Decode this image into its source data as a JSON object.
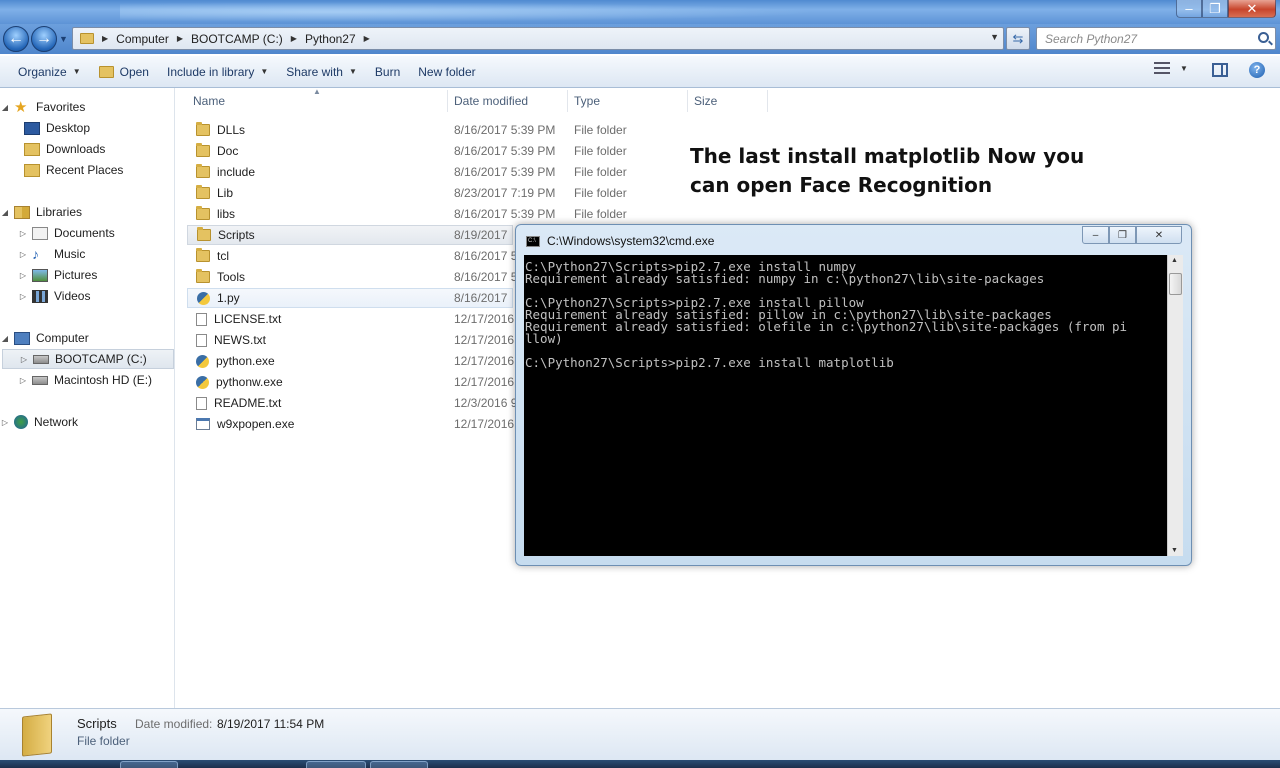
{
  "window": {
    "caption_buttons": {
      "minimize": "–",
      "maximize": "❐",
      "close": "✕"
    }
  },
  "nav": {
    "back": "←",
    "forward": "→",
    "breadcrumbs": [
      "Computer",
      "BOOTCAMP (C:)",
      "Python27"
    ],
    "search_placeholder": "Search Python27"
  },
  "toolbar": {
    "organize": "Organize",
    "open": "Open",
    "include_in_library": "Include in library",
    "share_with": "Share with",
    "burn": "Burn",
    "new_folder": "New folder",
    "help": "?"
  },
  "sidebar": {
    "favorites": "Favorites",
    "desktop": "Desktop",
    "downloads": "Downloads",
    "recent_places": "Recent Places",
    "libraries": "Libraries",
    "documents": "Documents",
    "music": "Music",
    "pictures": "Pictures",
    "videos": "Videos",
    "computer": "Computer",
    "bootcamp": "BOOTCAMP (C:)",
    "macintosh": "Macintosh HD (E:)",
    "network": "Network"
  },
  "columns": {
    "name": "Name",
    "date_modified": "Date modified",
    "type": "Type",
    "size": "Size"
  },
  "files": [
    {
      "name": "DLLs",
      "date": "8/16/2017 5:39 PM",
      "type": "File folder",
      "icon": "folder-icon"
    },
    {
      "name": "Doc",
      "date": "8/16/2017 5:39 PM",
      "type": "File folder",
      "icon": "folder-icon"
    },
    {
      "name": "include",
      "date": "8/16/2017 5:39 PM",
      "type": "File folder",
      "icon": "folder-icon"
    },
    {
      "name": "Lib",
      "date": "8/23/2017 7:19 PM",
      "type": "File folder",
      "icon": "folder-icon"
    },
    {
      "name": "libs",
      "date": "8/16/2017 5:39 PM",
      "type": "File folder",
      "icon": "folder-icon"
    },
    {
      "name": "Scripts",
      "date": "8/19/2017",
      "type": "",
      "icon": "folder-icon"
    },
    {
      "name": "tcl",
      "date": "8/16/2017 5",
      "type": "",
      "icon": "folder-icon"
    },
    {
      "name": "Tools",
      "date": "8/16/2017 5",
      "type": "",
      "icon": "folder-icon"
    },
    {
      "name": "1.py",
      "date": "8/16/2017",
      "type": "",
      "icon": "python-file-icon"
    },
    {
      "name": "LICENSE.txt",
      "date": "12/17/2016",
      "type": "",
      "icon": "text-file-icon"
    },
    {
      "name": "NEWS.txt",
      "date": "12/17/2016",
      "type": "",
      "icon": "text-file-icon"
    },
    {
      "name": "python.exe",
      "date": "12/17/2016",
      "type": "",
      "icon": "python-file-icon"
    },
    {
      "name": "pythonw.exe",
      "date": "12/17/2016",
      "type": "",
      "icon": "python-file-icon"
    },
    {
      "name": "README.txt",
      "date": "12/3/2016 9",
      "type": "",
      "icon": "text-file-icon"
    },
    {
      "name": "w9xpopen.exe",
      "date": "12/17/2016",
      "type": "",
      "icon": "exe-file-icon"
    }
  ],
  "caption_text": "The last install matplotlib Now you can open Face Recognition",
  "cmd": {
    "title": "C:\\Windows\\system32\\cmd.exe",
    "icon_text": "C:\\",
    "output": "C:\\Python27\\Scripts>pip2.7.exe install numpy\nRequirement already satisfied: numpy in c:\\python27\\lib\\site-packages\n\nC:\\Python27\\Scripts>pip2.7.exe install pillow\nRequirement already satisfied: pillow in c:\\python27\\lib\\site-packages\nRequirement already satisfied: olefile in c:\\python27\\lib\\site-packages (from pi\nllow)\n\nC:\\Python27\\Scripts>pip2.7.exe install matplotlib"
  },
  "details": {
    "name": "Scripts",
    "type": "File folder",
    "date_label": "Date modified:",
    "date_value": "8/19/2017 11:54 PM"
  },
  "colors": {
    "accent": "#4f86cc",
    "selection": "#dfe6ee",
    "console_bg": "#000000",
    "console_fg": "#c0c0c0"
  }
}
